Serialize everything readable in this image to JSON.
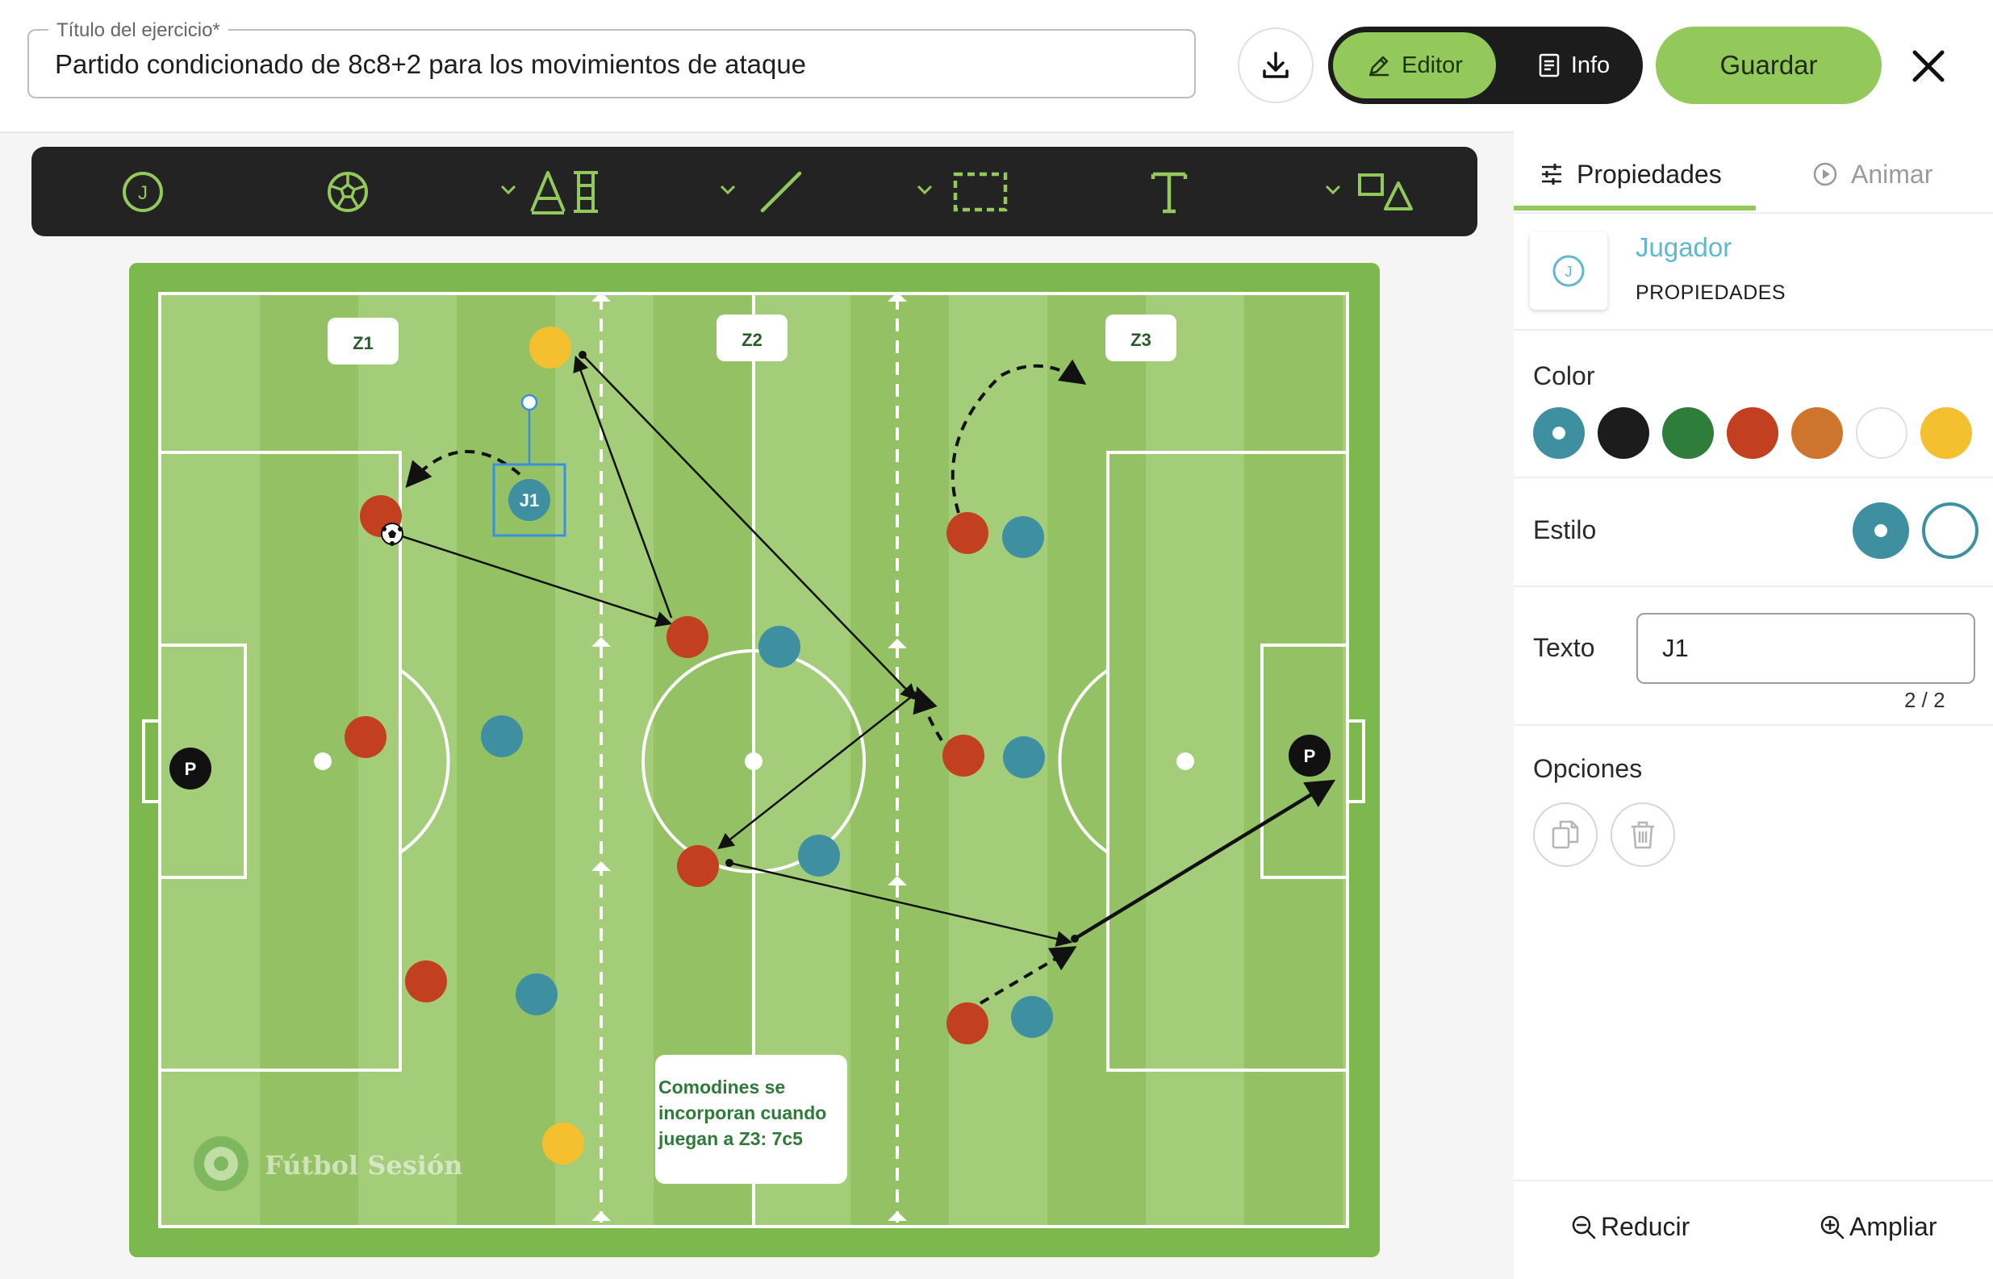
{
  "header": {
    "title_label": "Título del ejercicio*",
    "title_value": "Partido condicionado de 8c8+2 para los movimientos de ataque",
    "download_icon": "download-icon",
    "mode_editor": "Editor",
    "mode_info": "Info",
    "save_label": "Guardar"
  },
  "toolbar": {
    "tools": [
      "player-tool",
      "ball-tool",
      "text-label-tool",
      "line-tool",
      "selection-tool",
      "text-tool",
      "shapes-tool"
    ],
    "player_tool_glyph": "J",
    "text_tool_glyph": "T"
  },
  "field": {
    "zones": [
      "Z1",
      "Z2",
      "Z3"
    ],
    "goalkeepers": [
      "P",
      "P"
    ],
    "selected_player": "J1",
    "note": [
      "Comodines se",
      "incorporan cuando",
      "juegan a Z3: 7c5"
    ],
    "watermark": "Fútbol Sesión",
    "colors": {
      "grass_light": "#a4cd7a",
      "grass_dark": "#93c164",
      "border": "#7cb84e",
      "red_team": "#c2401f",
      "blue_team": "#3e8fa0",
      "joker": "#f5c02f",
      "goalkeeper": "#111111"
    }
  },
  "panel": {
    "tab_properties": "Propiedades",
    "tab_animate": "Animar",
    "element_title": "Jugador",
    "element_subtitle": "PROPIEDADES",
    "element_glyph": "J",
    "color_label": "Color",
    "colors": [
      "#3e8fa0",
      "#1c1c1c",
      "#2e7d3a",
      "#c2401f",
      "#cf742c",
      "#ffffff",
      "#f5c02f"
    ],
    "selected_color_index": 0,
    "style_label": "Estilo",
    "text_label": "Texto",
    "text_value": "J1",
    "text_counter": "2 / 2",
    "options_label": "Opciones",
    "zoom_out": "Reducir",
    "zoom_in": "Ampliar"
  }
}
